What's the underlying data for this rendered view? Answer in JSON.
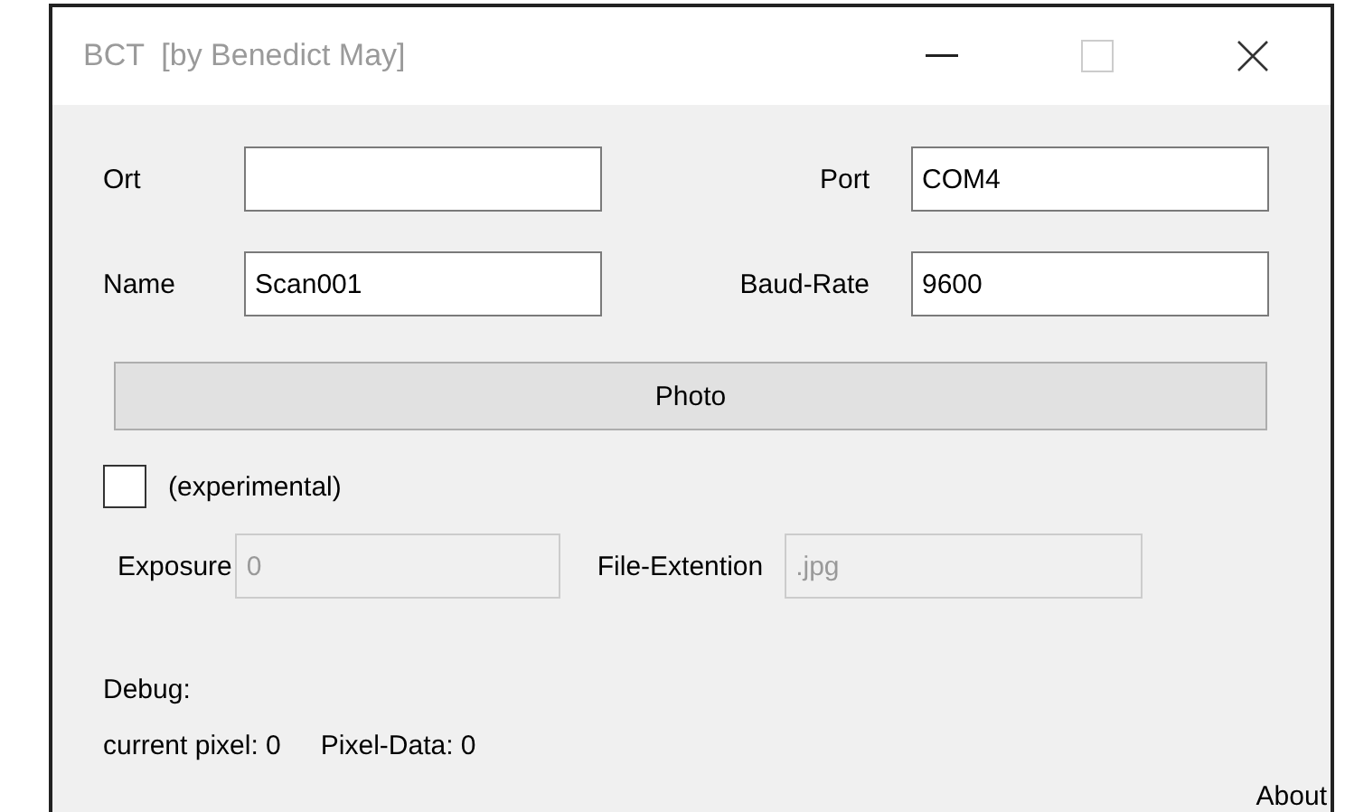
{
  "window": {
    "title": "BCT  [by Benedict May]",
    "maximize_disabled": true
  },
  "fields": [
    {
      "label": "Ort"
    },
    {
      "label": "Port",
      "value": "COM4"
    },
    {
      "label": "Name",
      "value": "Scan001"
    },
    {
      "label": "Baud-Rate",
      "value": "9600"
    }
  ],
  "photo_button": "Photo",
  "experimental": {
    "label": "(experimental)",
    "checked": false
  },
  "disabled_fields": [
    {
      "label": "Exposure",
      "value": "0",
      "disabled": true
    },
    {
      "label": "File-Extention",
      "value": ".jpg",
      "disabled": true
    }
  ],
  "debug": {
    "heading": "Debug:",
    "current_pixel_label": "current pixel:",
    "current_pixel": "0",
    "pixel_data_label": "Pixel-Data:",
    "pixel_data": "0"
  },
  "about_link": "About"
}
